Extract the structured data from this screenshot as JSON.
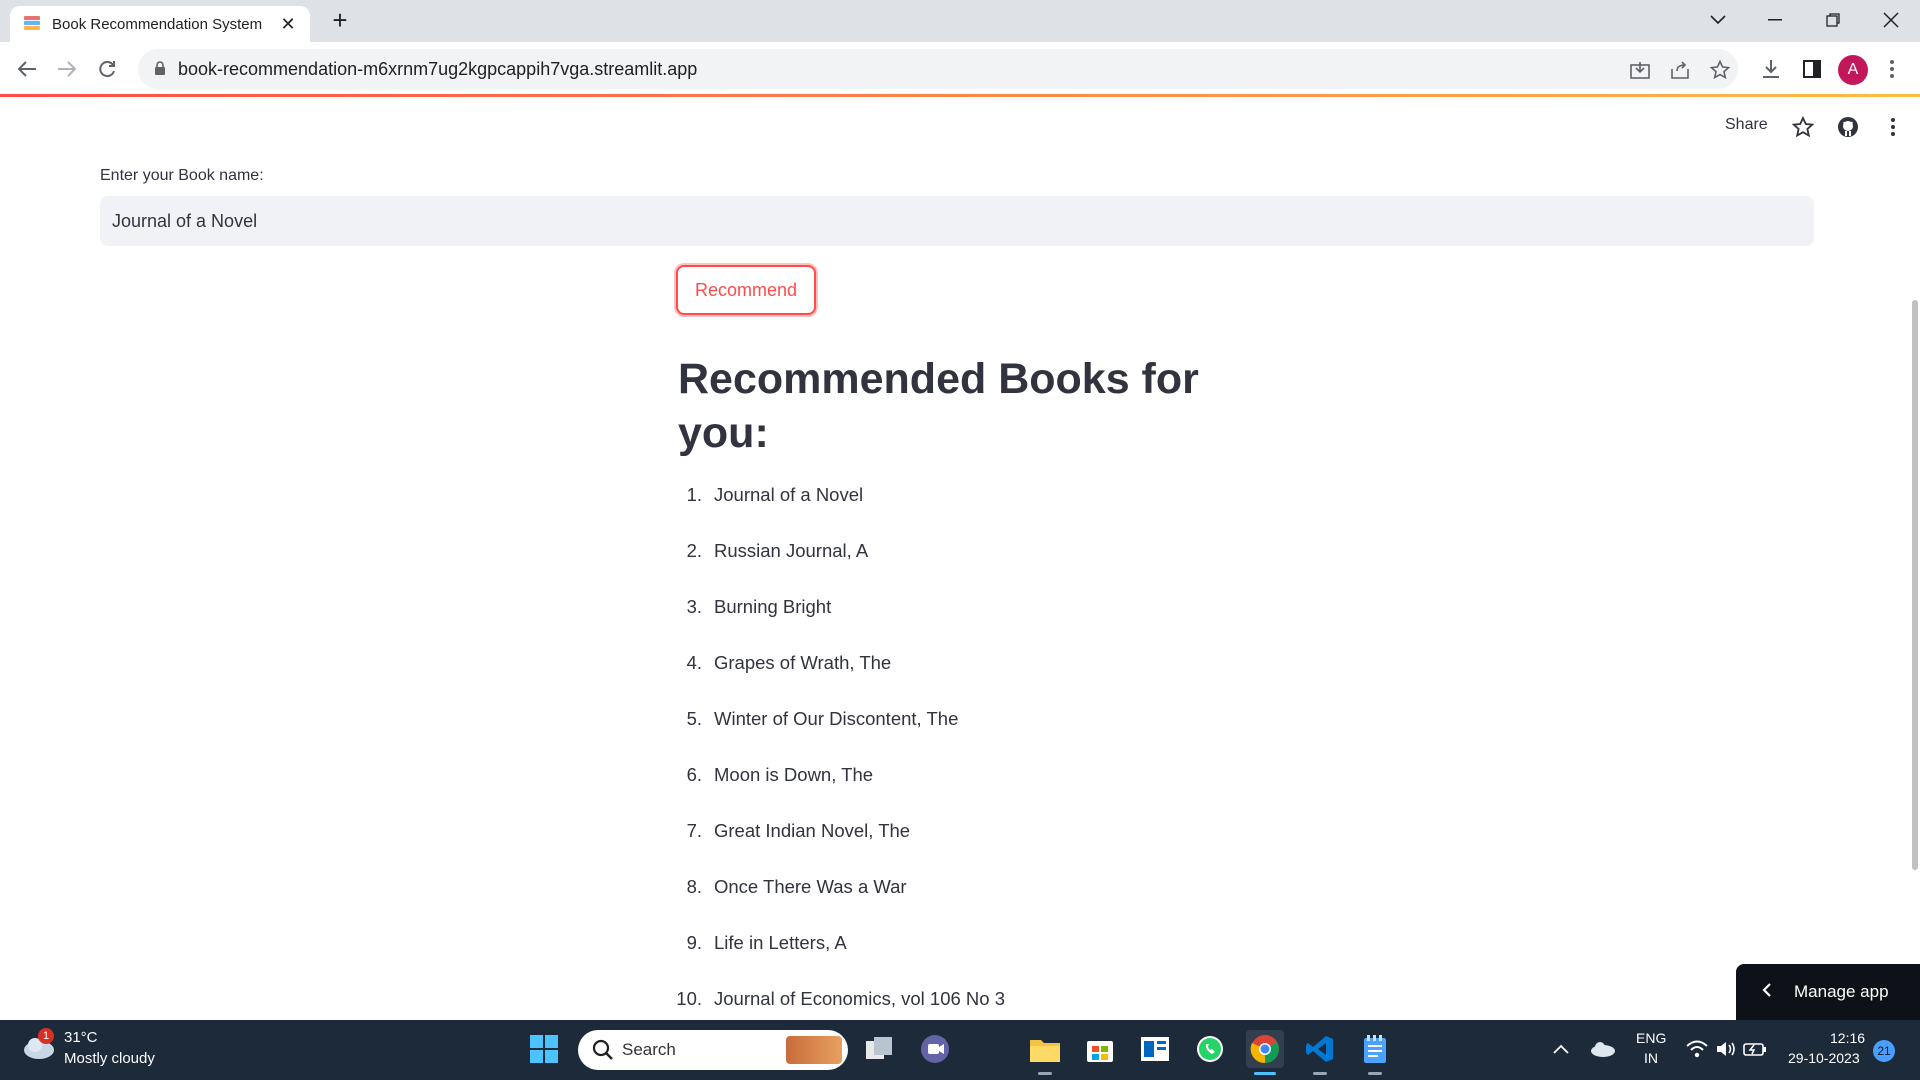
{
  "browser": {
    "tab_title": "Book Recommendation System",
    "url": "book-recommendation-m6xrnm7ug2kgpcappih7vga.streamlit.app",
    "profile_initial": "A"
  },
  "app_header": {
    "share_label": "Share"
  },
  "form": {
    "input_label": "Enter your Book name:",
    "input_value": "Journal of a Novel",
    "button_label": "Recommend"
  },
  "results": {
    "heading": "Recommended Books for you:",
    "books": [
      {
        "num": "1.",
        "title": "Journal of a Novel"
      },
      {
        "num": "2.",
        "title": "Russian Journal, A"
      },
      {
        "num": "3.",
        "title": "Burning Bright"
      },
      {
        "num": "4.",
        "title": "Grapes of Wrath, The"
      },
      {
        "num": "5.",
        "title": "Winter of Our Discontent, The"
      },
      {
        "num": "6.",
        "title": "Moon is Down, The"
      },
      {
        "num": "7.",
        "title": "Great Indian Novel, The"
      },
      {
        "num": "8.",
        "title": "Once There Was a War"
      },
      {
        "num": "9.",
        "title": "Life in Letters, A"
      },
      {
        "num": "10.",
        "title": "Journal of Economics, vol 106 No 3"
      }
    ]
  },
  "manage_app": {
    "label": "Manage app"
  },
  "taskbar": {
    "weather_badge": "1",
    "temperature": "31°C",
    "condition": "Mostly cloudy",
    "search_placeholder": "Search",
    "lang_line1": "ENG",
    "lang_line2": "IN",
    "time": "12:16",
    "date": "29-10-2023",
    "notification_count": "21"
  },
  "colors": {
    "accent": "#ff4b4b",
    "text": "#31333f",
    "input_bg": "#f0f2f6",
    "taskbar_bg": "#1c2a3a"
  }
}
